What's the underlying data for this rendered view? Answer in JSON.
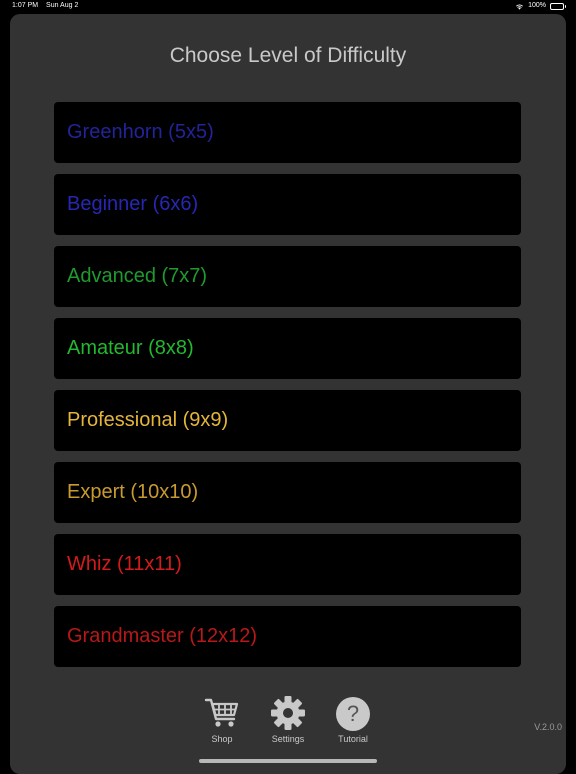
{
  "status": {
    "time": "1:07 PM",
    "date": "Sun Aug 2",
    "battery": "100%"
  },
  "title": "Choose Level of Difficulty",
  "levels": [
    {
      "label": "Greenhorn (5x5)",
      "color": "#23239a"
    },
    {
      "label": "Beginner (6x6)",
      "color": "#2727b4"
    },
    {
      "label": "Advanced (7x7)",
      "color": "#1f9a2e"
    },
    {
      "label": "Amateur (8x8)",
      "color": "#22b82f"
    },
    {
      "label": "Professional (9x9)",
      "color": "#e4b53a"
    },
    {
      "label": "Expert (10x10)",
      "color": "#c89a30"
    },
    {
      "label": "Whiz (11x11)",
      "color": "#d41b1b"
    },
    {
      "label": "Grandmaster (12x12)",
      "color": "#b81818"
    }
  ],
  "tabs": {
    "shop": {
      "label": "Shop",
      "icon": "cart-icon"
    },
    "settings": {
      "label": "Settings",
      "icon": "gear-icon"
    },
    "tutorial": {
      "label": "Tutorial",
      "icon": "help-icon",
      "glyph": "?"
    }
  },
  "version": "V.2.0.0"
}
